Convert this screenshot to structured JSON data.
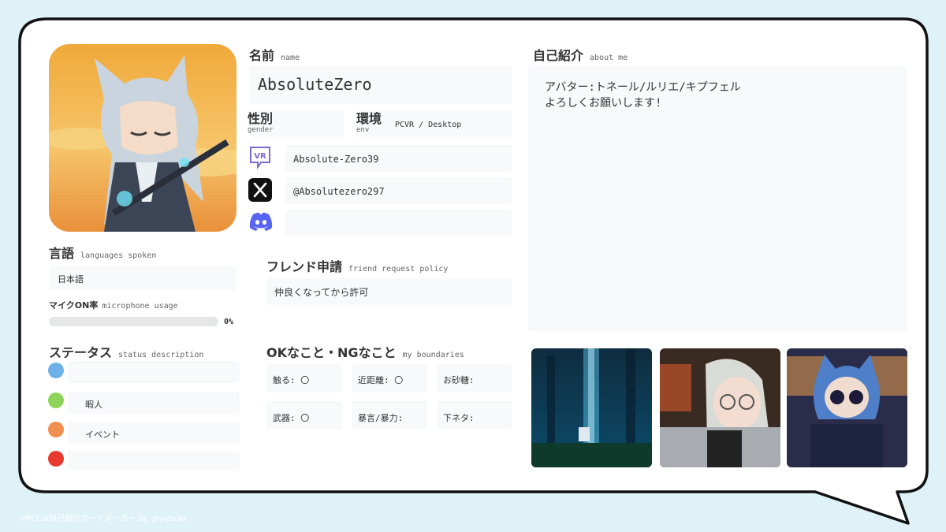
{
  "colors": {
    "page_bg": "#dff2f7",
    "card_bg": "#ffffff",
    "card_border": "#111111",
    "field_bg": "#f7f9fa",
    "status_blue": "#6cb2e8",
    "status_green": "#8ed45a",
    "status_orange": "#ef8f50",
    "status_red": "#e83a2e"
  },
  "avatar": {
    "icon": "wolf-girl-avatar-image"
  },
  "name": {
    "label": "名前",
    "sub": "name",
    "value": "AbsoluteZero"
  },
  "gender": {
    "label": "性別",
    "sub": "gender",
    "value": ""
  },
  "env": {
    "label": "環境",
    "sub": "env",
    "value": "PCVR / Desktop"
  },
  "socials": [
    {
      "icon": "vrchat-icon",
      "handle": "Absolute-Zero39"
    },
    {
      "icon": "x-icon",
      "handle": "@Absolutezero297"
    },
    {
      "icon": "discord-icon",
      "handle": ""
    }
  ],
  "friend_request": {
    "label": "フレンド申請",
    "sub": "friend request policy",
    "value": "仲良くなってから許可"
  },
  "boundaries": {
    "label": "OKなこと・NGなこと",
    "sub": "my boundaries",
    "items": [
      {
        "label": "触る:",
        "value": "〇"
      },
      {
        "label": "近距離:",
        "value": "〇"
      },
      {
        "label": "お砂糖:",
        "value": ""
      },
      {
        "label": "武器:",
        "value": "〇"
      },
      {
        "label": "暴言/暴力:",
        "value": ""
      },
      {
        "label": "下ネタ:",
        "value": ""
      }
    ]
  },
  "languages": {
    "label": "言語",
    "sub": "languages spoken",
    "value": "日本語"
  },
  "mic": {
    "label": "マイクON率",
    "sub": "microphone usage",
    "percent_text": "0%",
    "percent": 0
  },
  "status": {
    "label": "ステータス",
    "sub": "status description",
    "items": [
      {
        "color": "blue",
        "text": ""
      },
      {
        "color": "green",
        "text": "暇人"
      },
      {
        "color": "orange",
        "text": "イベント"
      },
      {
        "color": "red",
        "text": ""
      }
    ]
  },
  "about": {
    "label": "自己紹介",
    "sub": "about me",
    "lines": [
      "アバター:トネール/ルリエ/キプフェル",
      "よろしくお願いします!"
    ]
  },
  "photos": [
    {
      "icon": "forest-world-photo"
    },
    {
      "icon": "glasses-avatar-photo"
    },
    {
      "icon": "blue-hair-avatar-photo"
    }
  ],
  "footer": "VRChat自己紹介カードメーカー by @yota3d"
}
